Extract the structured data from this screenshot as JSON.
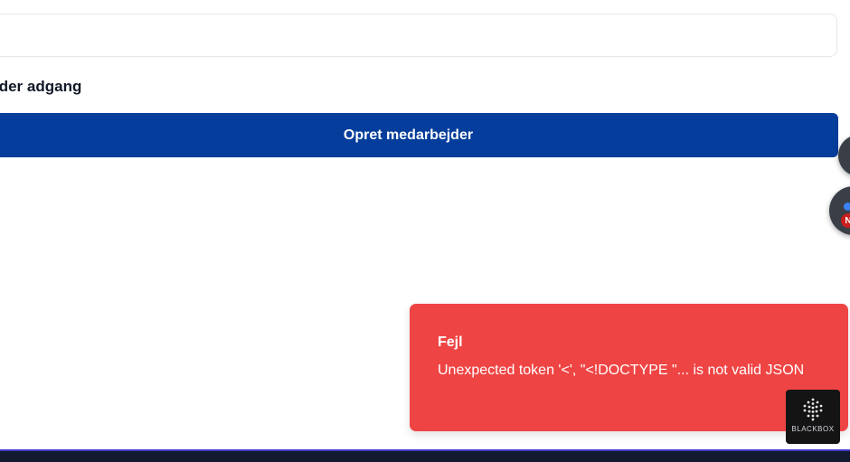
{
  "form": {
    "input_value": "",
    "access_label": "jder adgang",
    "create_button_label": "Opret medarbejder"
  },
  "fab": {
    "badge_letter": "N"
  },
  "toast": {
    "title": "Fejl",
    "message": "Unexpected token '<', \"<!DOCTYPE \"... is not valid JSON",
    "color": "#ef4444"
  },
  "watermark": {
    "text": "BLACKBOX"
  },
  "colors": {
    "primary_button": "#043d9b",
    "bottom_bar": "#121a2e",
    "bottom_bar_accent": "#4338ca"
  }
}
